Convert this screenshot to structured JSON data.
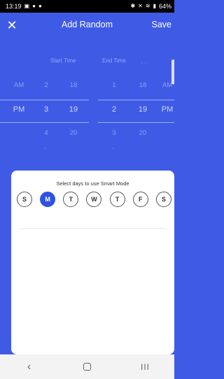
{
  "status_bar": {
    "time": "13:19",
    "battery": "64%",
    "left_icons": [
      "image-icon",
      "location-icon",
      "location-icon"
    ],
    "right_icons": [
      "bluetooth-icon",
      "mute-icon",
      "wifi-icon",
      "signal-icon"
    ]
  },
  "header": {
    "close_label": "✕",
    "title": "Add Random",
    "save_label": "Save"
  },
  "picker": {
    "start_label": "Start Time",
    "end_label": "End Time",
    "rows": [
      {
        "start_ampm": "AM",
        "start_hour": "2",
        "start_min": "18",
        "end_hour": "1",
        "end_min": "18",
        "end_ampm": "AM"
      },
      {
        "start_ampm": "PM",
        "start_hour": "3",
        "start_min": "19",
        "end_hour": "2",
        "end_min": "19",
        "end_ampm": "PM"
      },
      {
        "start_ampm": "",
        "start_hour": "4",
        "start_min": "20",
        "end_hour": "3",
        "end_min": "20",
        "end_ampm": ""
      }
    ]
  },
  "sheet": {
    "title": "Select days to use Smart Mode",
    "days": [
      {
        "label": "S",
        "active": false
      },
      {
        "label": "M",
        "active": true
      },
      {
        "label": "T",
        "active": false
      },
      {
        "label": "W",
        "active": false
      },
      {
        "label": "T",
        "active": false
      },
      {
        "label": "F",
        "active": false
      },
      {
        "label": "S",
        "active": false
      }
    ]
  },
  "nav": {
    "back": "‹",
    "recents": "III"
  },
  "colors": {
    "accent": "#3f5be6",
    "active_day": "#2e53e0"
  }
}
